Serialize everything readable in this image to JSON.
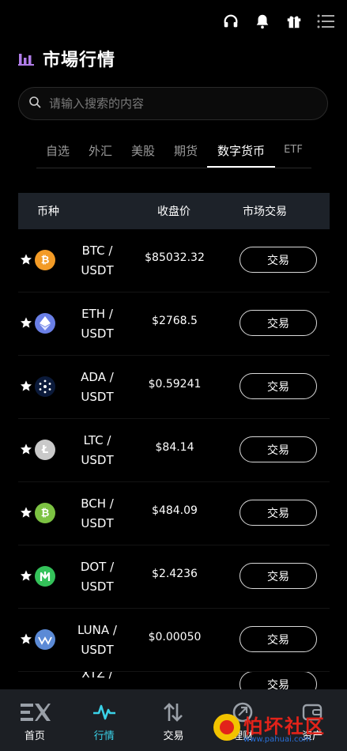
{
  "header": {
    "title": "市場行情",
    "icons": [
      "headset-icon",
      "bell-icon",
      "gift-icon",
      "menu-icon"
    ],
    "accent_color": "#b07de8"
  },
  "search": {
    "placeholder": "请输入搜索的内容",
    "value": ""
  },
  "tabs": [
    {
      "label": "自选",
      "active": false
    },
    {
      "label": "外汇",
      "active": false
    },
    {
      "label": "美股",
      "active": false
    },
    {
      "label": "期货",
      "active": false
    },
    {
      "label": "数字货币",
      "active": true
    },
    {
      "label": "ETF",
      "active": false
    }
  ],
  "table": {
    "headers": {
      "coin": "币种",
      "price": "收盘价",
      "market": "市场交易"
    },
    "rows": [
      {
        "pair_top": "BTC /",
        "pair_bottom": "USDT",
        "price": "$85032.32",
        "action": "交易",
        "coin_icon": "btc-icon",
        "coin_color": "#f39b26"
      },
      {
        "pair_top": "ETH /",
        "pair_bottom": "USDT",
        "price": "$2768.5",
        "action": "交易",
        "coin_icon": "eth-icon",
        "coin_color": "#6a7fe6"
      },
      {
        "pair_top": "ADA /",
        "pair_bottom": "USDT",
        "price": "$0.59241",
        "action": "交易",
        "coin_icon": "ada-icon",
        "coin_color": "#0b1a3a"
      },
      {
        "pair_top": "LTC /",
        "pair_bottom": "USDT",
        "price": "$84.14",
        "action": "交易",
        "coin_icon": "ltc-icon",
        "coin_color": "#c9c9c9"
      },
      {
        "pair_top": "BCH /",
        "pair_bottom": "USDT",
        "price": "$484.09",
        "action": "交易",
        "coin_icon": "bch-icon",
        "coin_color": "#7cc242"
      },
      {
        "pair_top": "DOT /",
        "pair_bottom": "USDT",
        "price": "$2.4236",
        "action": "交易",
        "coin_icon": "dot-icon",
        "coin_color": "#34c25a"
      },
      {
        "pair_top": "LUNA /",
        "pair_bottom": "USDT",
        "price": "$0.00050",
        "action": "交易",
        "coin_icon": "luna-icon",
        "coin_color": "#5b8ad6"
      },
      {
        "pair_top": "XTZ /",
        "pair_bottom": "",
        "price": "",
        "action": "交易",
        "coin_icon": "xtz-icon",
        "coin_color": "#2c7df7"
      }
    ]
  },
  "bottom_nav": [
    {
      "label": "首页",
      "icon": "ex-logo-icon",
      "active": false
    },
    {
      "label": "行情",
      "icon": "pulse-icon",
      "active": true
    },
    {
      "label": "交易",
      "icon": "swap-arrows-icon",
      "active": false
    },
    {
      "label": "理财",
      "icon": "finance-icon",
      "active": false
    },
    {
      "label": "资产",
      "icon": "wallet-icon",
      "active": false
    }
  ],
  "watermark": {
    "text": "怕坏社区",
    "url_text": "www.pahuai.com"
  }
}
